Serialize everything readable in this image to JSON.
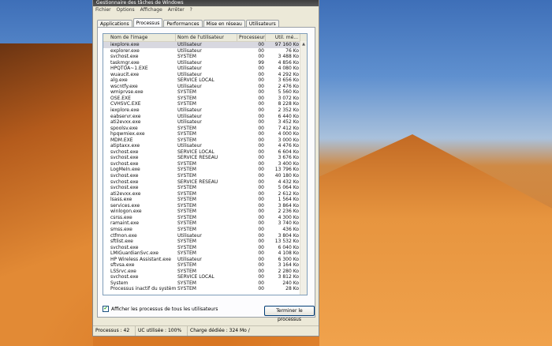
{
  "window": {
    "title": "Gestionnaire des tâches de Windows"
  },
  "menu": [
    "Fichier",
    "Options",
    "Affichage",
    "Arrêter",
    "?"
  ],
  "tabs": [
    "Applications",
    "Processus",
    "Performances",
    "Mise en réseau",
    "Utilisateurs"
  ],
  "active_tab": "Processus",
  "columns": [
    "Nom de l'image",
    "Nom de l'utilisateur",
    "Processeur",
    "Util. mé..."
  ],
  "processes": [
    [
      "iexplore.exe",
      "Utilisateur",
      "00",
      "97 160 Ko"
    ],
    [
      "explorer.exe",
      "Utilisateur",
      "00",
      "76 Ko"
    ],
    [
      "svchost.exe",
      "SYSTEM",
      "00",
      "3 488 Ko"
    ],
    [
      "taskmgr.exe",
      "Utilisateur",
      "99",
      "4 856 Ko"
    ],
    [
      "HPQTOA~1.EXE",
      "Utilisateur",
      "00",
      "4 080 Ko"
    ],
    [
      "wuaucit.exe",
      "Utilisateur",
      "00",
      "4 292 Ko"
    ],
    [
      "alg.exe",
      "SERVICE LOCAL",
      "00",
      "3 656 Ko"
    ],
    [
      "wscntfy.exe",
      "Utilisateur",
      "00",
      "2 476 Ko"
    ],
    [
      "wmiprvse.exe",
      "SYSTEM",
      "00",
      "5 560 Ko"
    ],
    [
      "OSE.EXE",
      "SYSTEM",
      "00",
      "3 072 Ko"
    ],
    [
      "CVHSVC.EXE",
      "SYSTEM",
      "00",
      "8 228 Ko"
    ],
    [
      "iexplore.exe",
      "Utilisateur",
      "00",
      "2 352 Ko"
    ],
    [
      "eabservr.exe",
      "Utilisateur",
      "00",
      "6 440 Ko"
    ],
    [
      "ati2evxx.exe",
      "Utilisateur",
      "00",
      "3 452 Ko"
    ],
    [
      "spoolsv.exe",
      "SYSTEM",
      "00",
      "7 412 Ko"
    ],
    [
      "hpqwmiex.exe",
      "SYSTEM",
      "00",
      "4 000 Ko"
    ],
    [
      "MDM.EXE",
      "SYSTEM",
      "00",
      "3 000 Ko"
    ],
    [
      "atiptaxx.exe",
      "Utilisateur",
      "00",
      "4 476 Ko"
    ],
    [
      "svchost.exe",
      "SERVICE LOCAL",
      "00",
      "6 604 Ko"
    ],
    [
      "svchost.exe",
      "SERVICE RÉSEAU",
      "00",
      "3 676 Ko"
    ],
    [
      "svchost.exe",
      "SYSTEM",
      "00",
      "3 400 Ko"
    ],
    [
      "LogMeIn.exe",
      "SYSTEM",
      "00",
      "13 796 Ko"
    ],
    [
      "svchost.exe",
      "SYSTEM",
      "00",
      "40 180 Ko"
    ],
    [
      "svchost.exe",
      "SERVICE RÉSEAU",
      "00",
      "4 432 Ko"
    ],
    [
      "svchost.exe",
      "SYSTEM",
      "00",
      "5 064 Ko"
    ],
    [
      "ati2evxx.exe",
      "SYSTEM",
      "00",
      "2 612 Ko"
    ],
    [
      "lsass.exe",
      "SYSTEM",
      "00",
      "1 564 Ko"
    ],
    [
      "services.exe",
      "SYSTEM",
      "00",
      "3 864 Ko"
    ],
    [
      "winlogon.exe",
      "SYSTEM",
      "00",
      "2 236 Ko"
    ],
    [
      "csrss.exe",
      "SYSTEM",
      "00",
      "4 300 Ko"
    ],
    [
      "ramaint.exe",
      "SYSTEM",
      "00",
      "3 740 Ko"
    ],
    [
      "smss.exe",
      "SYSTEM",
      "00",
      "436 Ko"
    ],
    [
      "ctfmon.exe",
      "Utilisateur",
      "00",
      "3 804 Ko"
    ],
    [
      "sftlist.exe",
      "SYSTEM",
      "00",
      "13 532 Ko"
    ],
    [
      "svchost.exe",
      "SYSTEM",
      "00",
      "6 040 Ko"
    ],
    [
      "LMIGuardianSvc.exe",
      "SYSTEM",
      "00",
      "4 108 Ko"
    ],
    [
      "HP Wireless Assistant.exe",
      "Utilisateur",
      "00",
      "6 300 Ko"
    ],
    [
      "sftvsa.exe",
      "SYSTEM",
      "00",
      "3 164 Ko"
    ],
    [
      "LSSrvc.exe",
      "SYSTEM",
      "00",
      "2 280 Ko"
    ],
    [
      "svchost.exe",
      "SERVICE LOCAL",
      "00",
      "3 812 Ko"
    ],
    [
      "System",
      "SYSTEM",
      "00",
      "240 Ko"
    ],
    [
      "Processus inactif du système",
      "SYSTEM",
      "00",
      "28 Ko"
    ]
  ],
  "show_all_checkbox": {
    "label": "Afficher les processus de tous les utilisateurs",
    "checked": true
  },
  "end_button": "Terminer le processus",
  "status": {
    "processes": "Processus : 42",
    "cpu": "UC utilisée : 100%",
    "commit": "Charge dédiée : 324 Mo /"
  }
}
